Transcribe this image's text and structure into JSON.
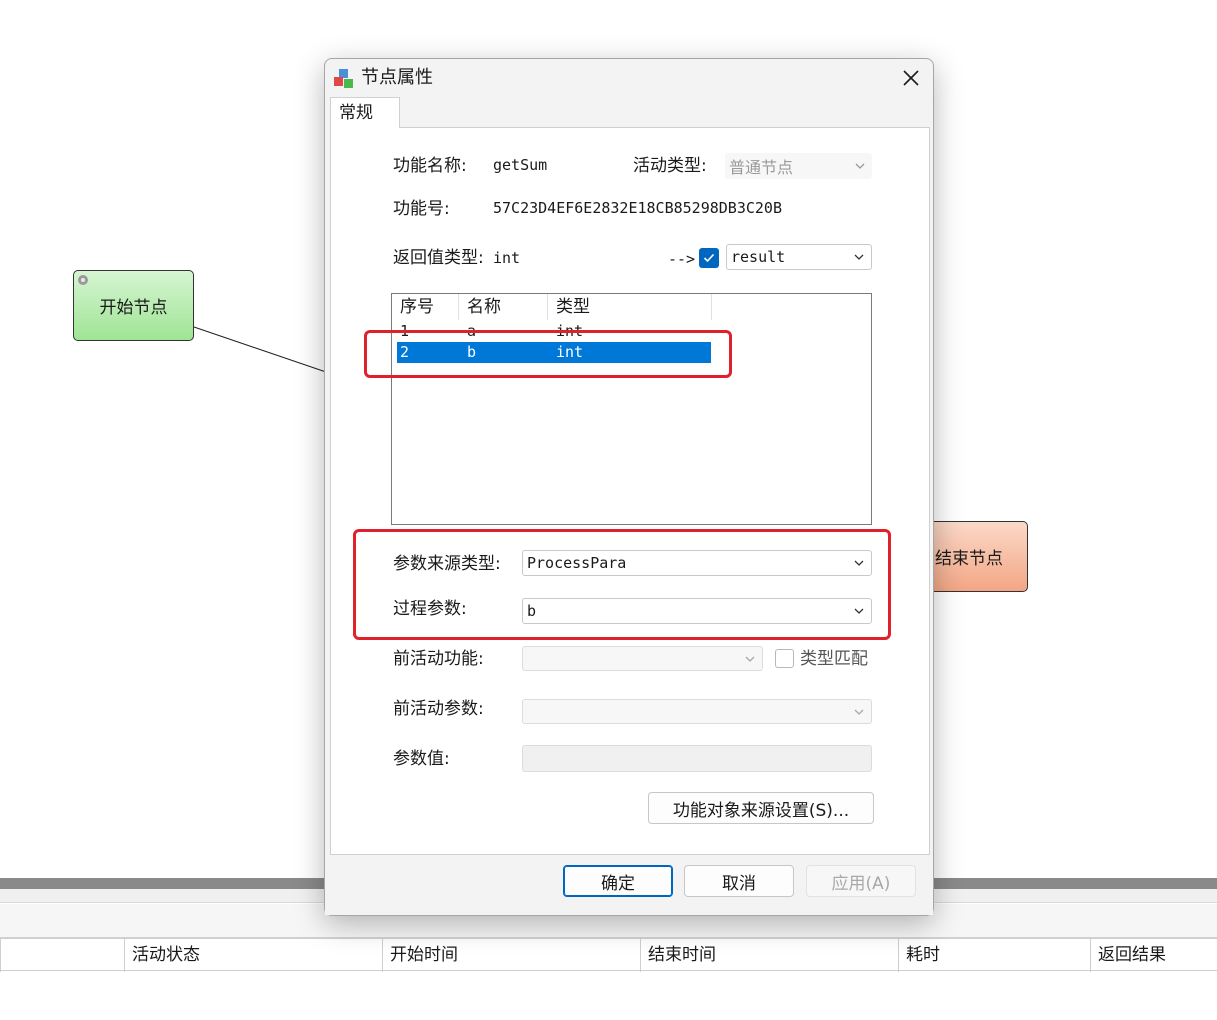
{
  "canvas": {
    "start_node": "开始节点",
    "end_node": "结束节点"
  },
  "bottom_grid": {
    "columns": [
      "活动状态",
      "开始时间",
      "结束时间",
      "耗时",
      "返回结果"
    ]
  },
  "dialog": {
    "title": "节点属性",
    "tab": "常规",
    "function_name_label": "功能名称:",
    "function_name_value": "getSum",
    "activity_type_label": "活动类型:",
    "activity_type_value": "普通节点",
    "function_id_label": "功能号:",
    "function_id_value": "57C23D4EF6E2832E18CB85298DB3C20B",
    "return_type_label": "返回值类型:",
    "return_type_value": "int",
    "arrow_text": "-->",
    "return_target_value": "result",
    "param_table": {
      "headers": [
        "序号",
        "名称",
        "类型"
      ],
      "rows": [
        {
          "index": "1",
          "name": "a",
          "type": "int",
          "selected": false
        },
        {
          "index": "2",
          "name": "b",
          "type": "int",
          "selected": true
        }
      ]
    },
    "param_source_type_label": "参数来源类型:",
    "param_source_type_value": "ProcessPara",
    "process_param_label": "过程参数:",
    "process_param_value": "b",
    "prev_activity_function_label": "前活动功能:",
    "prev_activity_function_value": "",
    "type_match_label": "类型匹配",
    "prev_activity_param_label": "前活动参数:",
    "prev_activity_param_value": "",
    "param_value_label": "参数值:",
    "param_value_value": "",
    "source_settings_button": "功能对象来源设置(S)...",
    "ok_button": "确定",
    "cancel_button": "取消",
    "apply_button": "应用(A)"
  },
  "colors": {
    "highlight": "#e0202a",
    "selection": "#0078d7",
    "accent": "#0067c0"
  }
}
